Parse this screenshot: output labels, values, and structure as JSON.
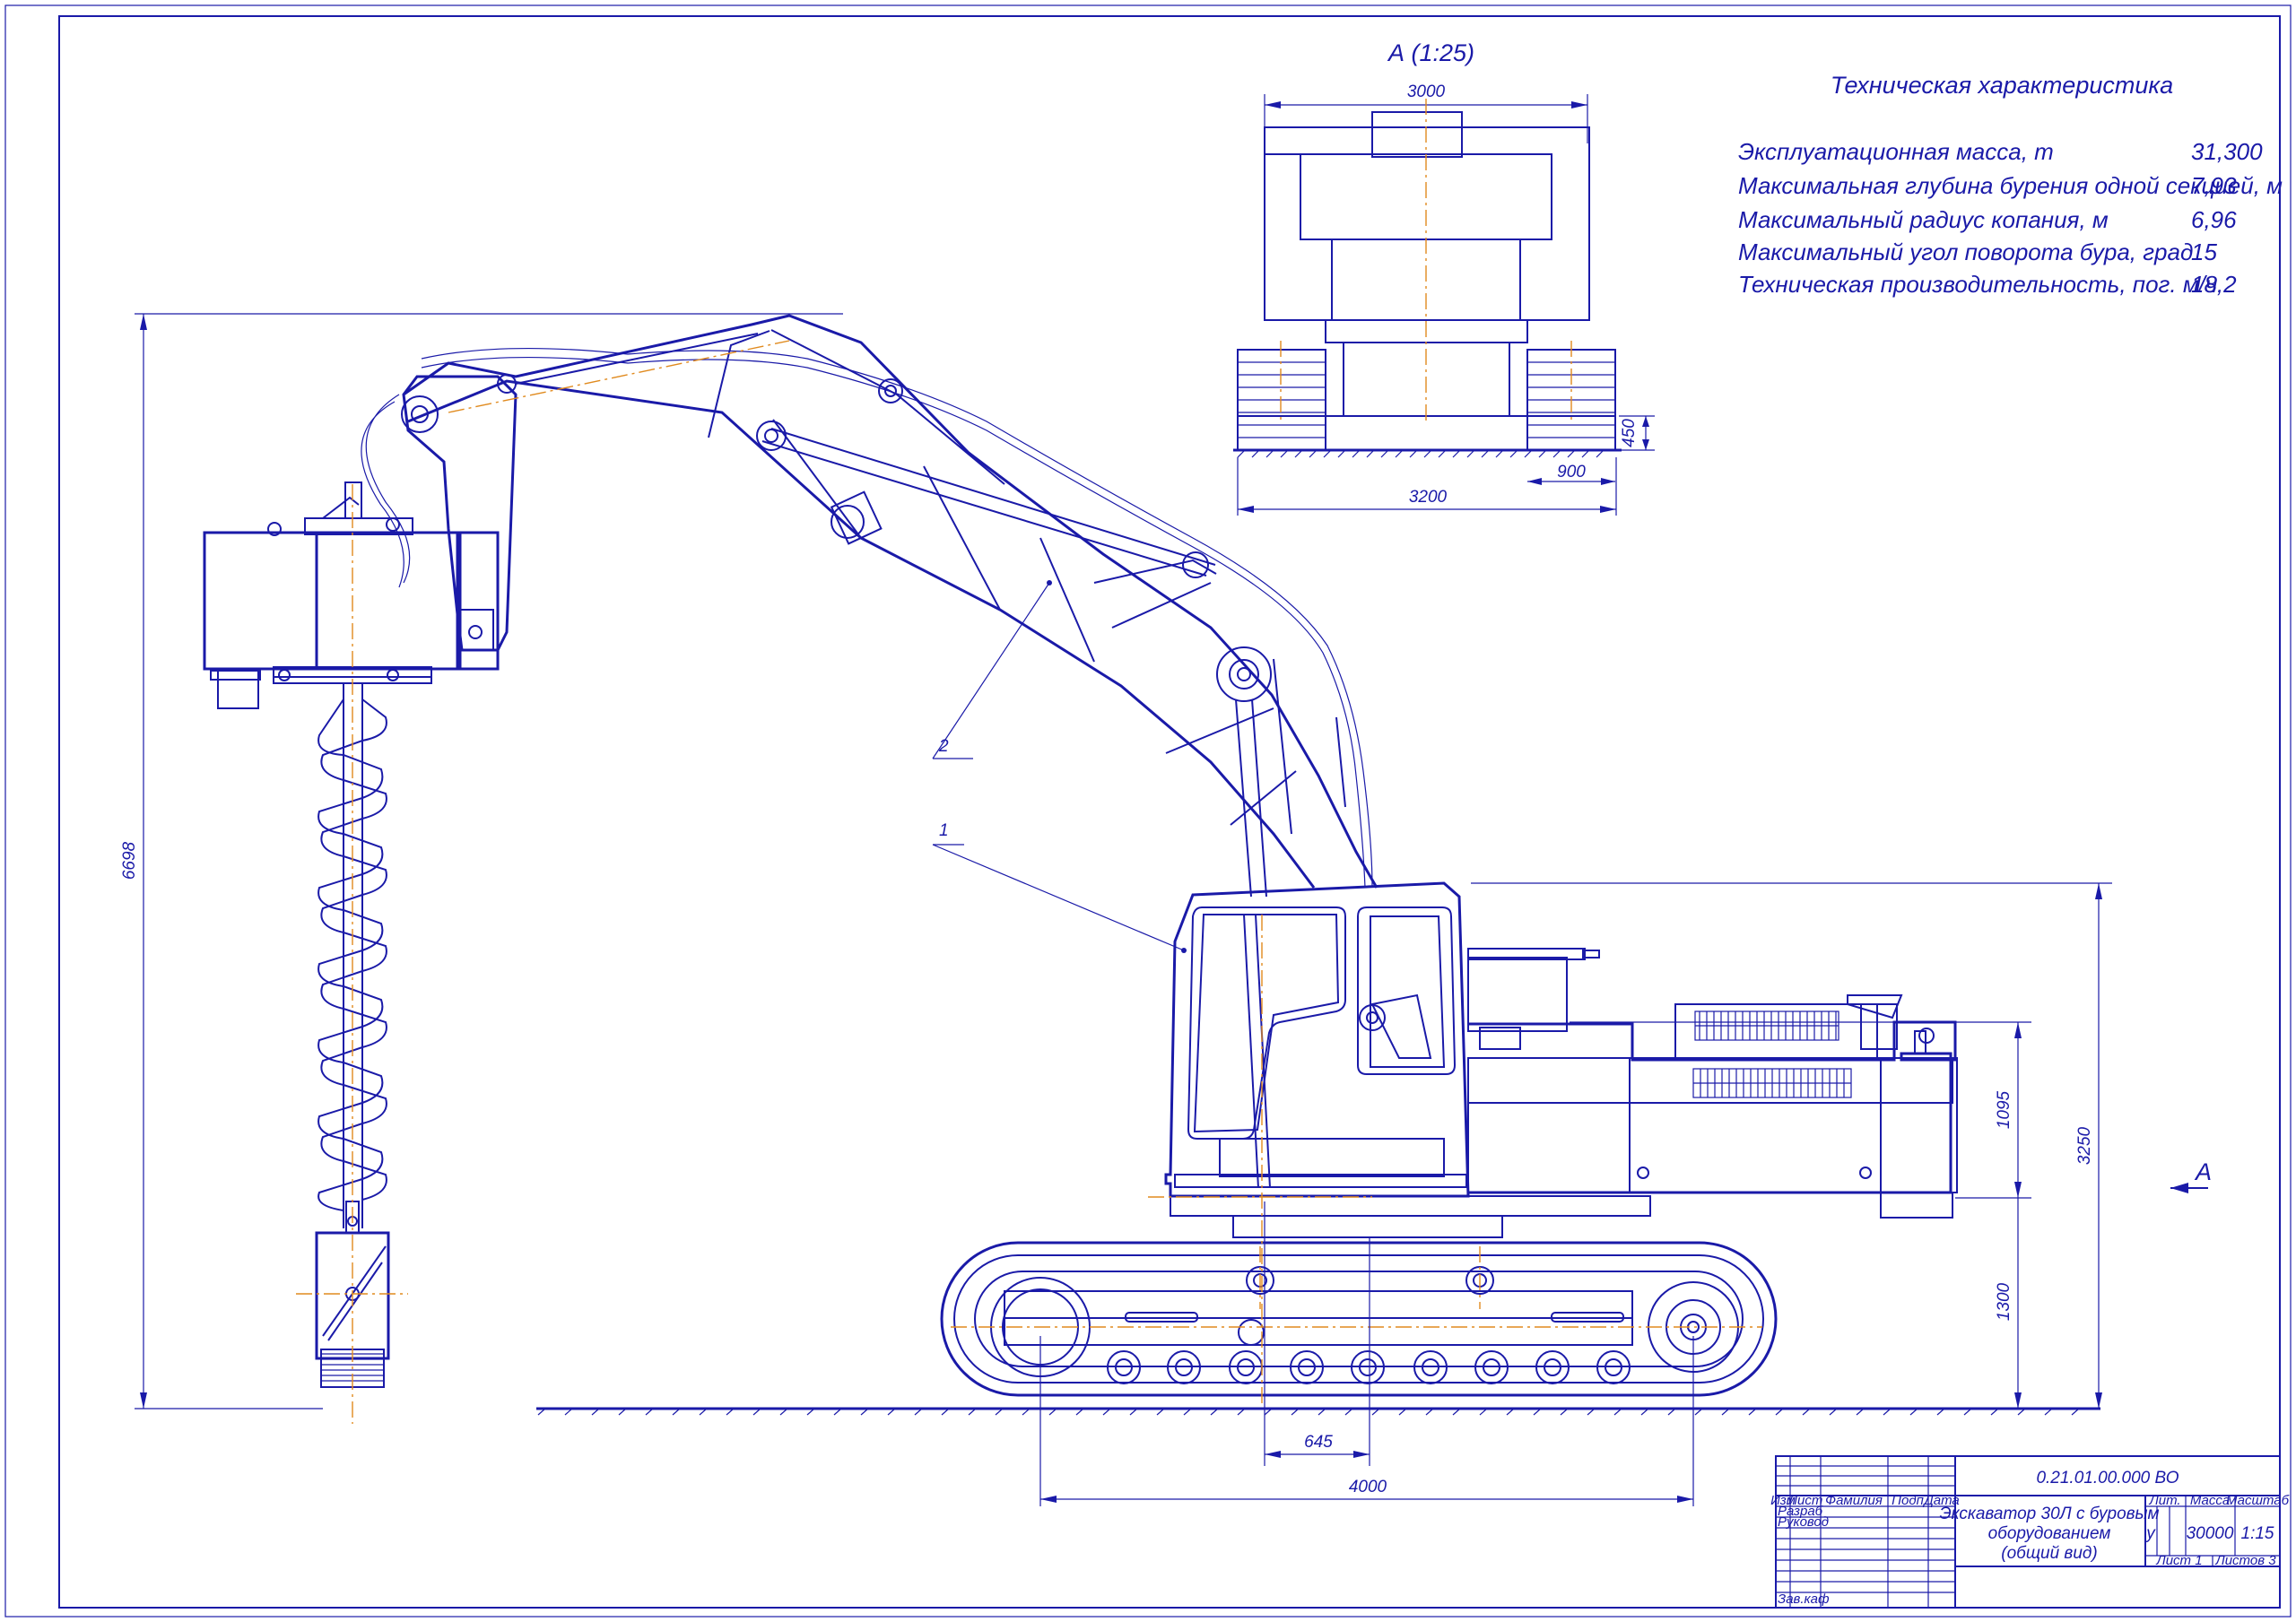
{
  "view_label": "А (1:25)",
  "view_arrow_label": "А",
  "specs": {
    "title": "Техническая характеристика",
    "rows": [
      {
        "label": "Эксплуатационная масса, т",
        "value": "31,300"
      },
      {
        "label": "Максимальная глубина бурения одной секцией, м",
        "value": "7,93"
      },
      {
        "label": "Максимальный радиус копания, м",
        "value": "6,96"
      },
      {
        "label": "Максимальный угол поворота бура, град",
        "value": "15"
      },
      {
        "label": "Техническая производительность, пог. м/ч",
        "value": "18,2"
      }
    ]
  },
  "dimensions": {
    "top_width": "3000",
    "track_width": "3200",
    "track_shoe": "900",
    "clearance": "450",
    "overall_height": "6698",
    "cab_height": "3250",
    "engine_height": "1095",
    "track_height": "1300",
    "offset": "645",
    "track_length": "4000"
  },
  "callouts": {
    "part1": "1",
    "part2": "2"
  },
  "title_block": {
    "doc_number": "0.21.01.00.000 ВО",
    "name_line1": "Экскаватор 30Л с буровым",
    "name_line2": "оборудованием",
    "name_line3": "(общий вид)",
    "col_lit": "Лит.",
    "col_mass": "Масса",
    "col_scale": "Масштаб",
    "lit_value": "у",
    "mass_value": "30000",
    "scale_value": "1:15",
    "sheet": "Лист 1",
    "sheets": "Листов 3",
    "hdr_izm": "Изм",
    "hdr_list": "Лист",
    "hdr_fio": "Фамилия",
    "hdr_podp": "Подп",
    "hdr_data": "Дата",
    "role_razrab": "Разраб",
    "role_rukovod": "Руковод",
    "role_zavkaf": "Зав.каф"
  },
  "colors": {
    "line": "#1a1aa8",
    "axis": "#e08a1e",
    "paper": "#ffffff"
  }
}
